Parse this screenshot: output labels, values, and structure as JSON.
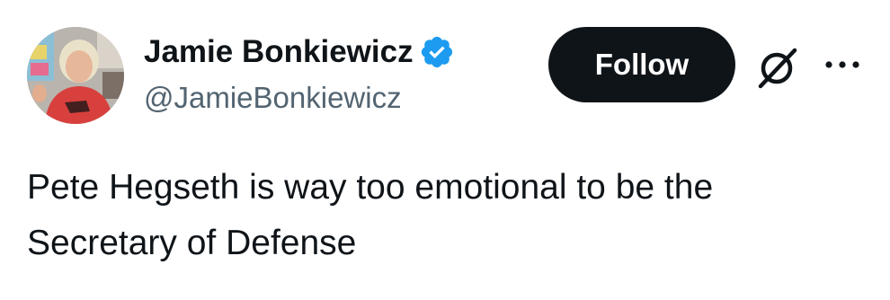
{
  "user": {
    "display_name": "Jamie Bonkiewicz",
    "handle": "@JamieBonkiewicz",
    "verified": true,
    "avatar_icon": "profile-photo"
  },
  "actions": {
    "follow_label": "Follow",
    "grok_icon": "grok-icon",
    "more_icon": "more-options-icon"
  },
  "tweet": {
    "text": "Pete Hegseth is way too emotional to be the Secretary of Defense"
  },
  "colors": {
    "text_primary": "#0f1419",
    "text_secondary": "#536471",
    "verified_blue": "#1d9bf0",
    "follow_bg": "#0f1419",
    "follow_text": "#ffffff"
  }
}
